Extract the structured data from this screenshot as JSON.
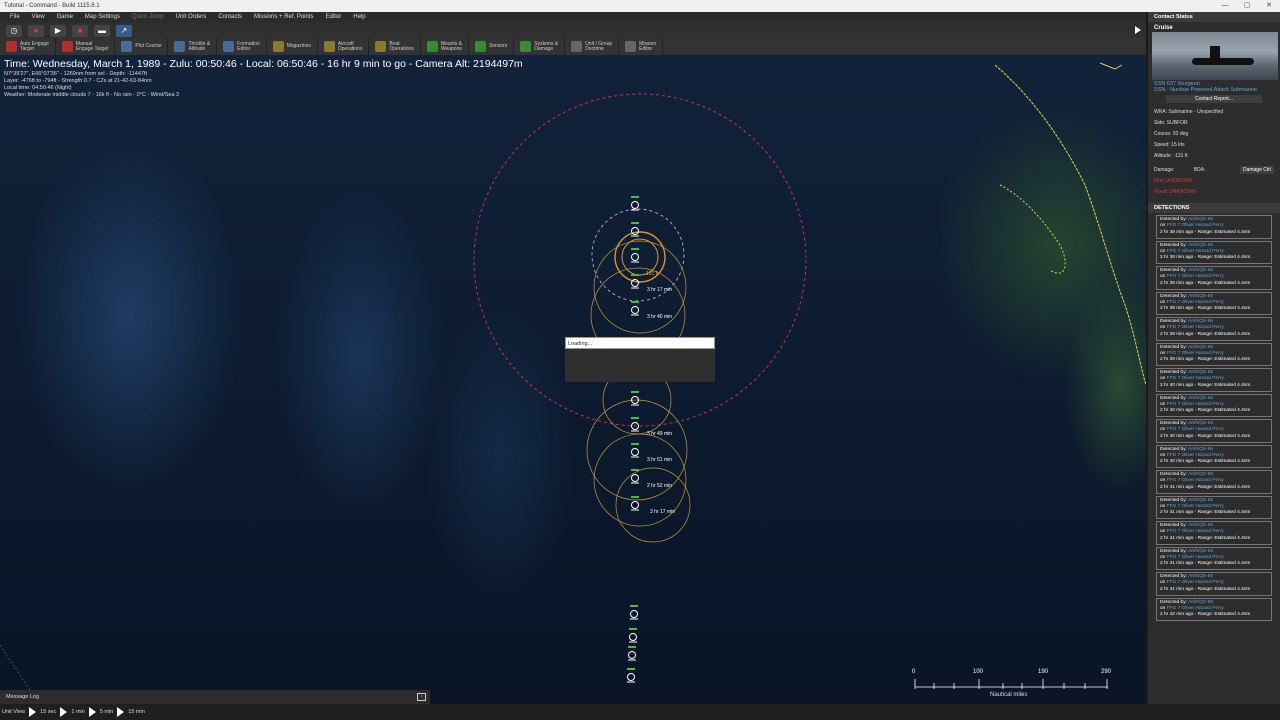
{
  "window": {
    "title": "Tutorial - Command - Build 1115.8.1",
    "controls": [
      "—",
      "▢",
      "✕"
    ]
  },
  "menu": [
    "File",
    "View",
    "Game",
    "Map Settings",
    "Quick Jump",
    "Unit Orders",
    "Contacts",
    "Missions + Ref. Points",
    "Editor",
    "Help"
  ],
  "toolbar2": [
    {
      "label": "Auto Engage\nTarget",
      "color": "#b03030"
    },
    {
      "label": "Manual\nEngage Target",
      "color": "#b03030"
    },
    {
      "label": "Plot Course",
      "color": "#4a6a9a"
    },
    {
      "label": "Throttle &\nAltitude",
      "color": "#4a6a9a"
    },
    {
      "label": "Formation\nEditor",
      "color": "#4a6a9a"
    },
    {
      "label": "Magazines",
      "color": "#8a7a30"
    },
    {
      "label": "Aircraft\nOperations",
      "color": "#8a7a30"
    },
    {
      "label": "Boat\nOperations",
      "color": "#8a7a30"
    },
    {
      "label": "Mounts &\nWeapons",
      "color": "#3a8a3a"
    },
    {
      "label": "Sensors",
      "color": "#3a8a3a"
    },
    {
      "label": "Systems &\nDamage",
      "color": "#3a8a3a"
    },
    {
      "label": "Unit / Group\nDoctrine",
      "color": "#666666"
    },
    {
      "label": "Mission\nEditor",
      "color": "#666666"
    }
  ],
  "status": {
    "time": "Time: Wednesday, March 1, 1989 - Zulu: 00:50:46 - Local: 06:50:46 - 16 hr 9 min to go -  Camera Alt: 2194497m",
    "line1": "N7°39'27\", E66°07'36\" - 1269nm from sel - Depth: -11447ft",
    "line2": "Layer: -476ft to -794ft - Strength 0.7 - CZs at 21-42-63-84nm",
    "line3": "Local time: 04:50:46 (Night)",
    "line4": "Weather: Moderate middle clouds 7 - 16k ft - No rain - 0°C - Wind/Sea 3"
  },
  "loading": "Loading...",
  "unit_labels": [
    {
      "text": "3 hr 17 min",
      "color": "white"
    },
    {
      "text": "3 hr 40 min",
      "color": "white"
    },
    {
      "text": "3 hr 49 min",
      "color": "white"
    },
    {
      "text": "3 hr 51 min",
      "color": "white"
    },
    {
      "text": "2 hr 52 min",
      "color": "white"
    },
    {
      "text": "3 hr 17 min",
      "color": "white"
    },
    {
      "text": "131 ft",
      "color": "orange"
    }
  ],
  "scale": {
    "ticks": [
      "0",
      "100",
      "190",
      "290"
    ],
    "unit": "Nautical miles"
  },
  "message_log": "Message Log",
  "bottom_bar": [
    "Unit View",
    "15 sec",
    "1 min",
    "5 min",
    "15 min"
  ],
  "panel": {
    "header": "Contact Status",
    "name": "Cruise",
    "class_link": "SSN 637 Sturgeon",
    "class_desc": "SSN - Nuclear Powered Attack Submarine",
    "report_button": "Contact Report...",
    "info": [
      "WRA: Submarine - Unspecified",
      "Side: SUBFOR",
      "Course: 93 deg",
      "Speed: 15 kts",
      "Altitude: -131 ft"
    ],
    "damage_label": "Damage:",
    "bda_label": "BDA:",
    "damage_button": "Damage Ctrl",
    "fire": "Fire: UNKNOWN",
    "flood": "Flood: UNKNOWN",
    "detections_header": "DETECTIONS",
    "detections": [
      {
        "sensor": "AN/SQS-56",
        "platform": "FFG 7 Oliver Hazard Perry",
        "ago": "2 hr 38 min ago",
        "range": "Range: Estimated 4.4nm"
      },
      {
        "sensor": "AN/SQS-56",
        "platform": "FFG 7 Oliver Hazard Perry",
        "ago": "2 hr 38 min ago",
        "range": "Range: Estimated 4.4nm"
      },
      {
        "sensor": "AN/SQS-56",
        "platform": "FFG 7 Oliver Hazard Perry",
        "ago": "2 hr 39 min ago",
        "range": "Range: Estimated 4.4nm"
      },
      {
        "sensor": "AN/SQS-56",
        "platform": "FFG 7 Oliver Hazard Perry",
        "ago": "2 hr 39 min ago",
        "range": "Range: Estimated 4.4nm"
      },
      {
        "sensor": "AN/SQS-56",
        "platform": "FFG 7 Oliver Hazard Perry",
        "ago": "2 hr 39 min ago",
        "range": "Range: Estimated 4.4nm"
      },
      {
        "sensor": "AN/SQS-56",
        "platform": "FFG 7 Oliver Hazard Perry",
        "ago": "2 hr 39 min ago",
        "range": "Range: Estimated 4.4nm"
      },
      {
        "sensor": "AN/SQS-56",
        "platform": "FFG 7 Oliver Hazard Perry",
        "ago": "2 hr 40 min ago",
        "range": "Range: Estimated 4.4nm"
      },
      {
        "sensor": "AN/SQS-56",
        "platform": "FFG 7 Oliver Hazard Perry",
        "ago": "2 hr 40 min ago",
        "range": "Range: Estimated 4.4nm"
      },
      {
        "sensor": "AN/SQS-56",
        "platform": "FFG 7 Oliver Hazard Perry",
        "ago": "2 hr 40 min ago",
        "range": "Range: Estimated 4.4nm"
      },
      {
        "sensor": "AN/SQS-56",
        "platform": "FFG 7 Oliver Hazard Perry",
        "ago": "2 hr 40 min ago",
        "range": "Range: Estimated 4.4nm"
      },
      {
        "sensor": "AN/SQS-56",
        "platform": "FFG 7 Oliver Hazard Perry",
        "ago": "2 hr 41 min ago",
        "range": "Range: Estimated 4.4nm"
      },
      {
        "sensor": "AN/SQS-56",
        "platform": "FFG 7 Oliver Hazard Perry",
        "ago": "2 hr 41 min ago",
        "range": "Range: Estimated 4.4nm"
      },
      {
        "sensor": "AN/SQS-56",
        "platform": "FFG 7 Oliver Hazard Perry",
        "ago": "2 hr 41 min ago",
        "range": "Range: Estimated 4.4nm"
      },
      {
        "sensor": "AN/SQS-56",
        "platform": "FFG 7 Oliver Hazard Perry",
        "ago": "2 hr 41 min ago",
        "range": "Range: Estimated 4.4nm"
      },
      {
        "sensor": "AN/SQS-56",
        "platform": "FFG 7 Oliver Hazard Perry",
        "ago": "2 hr 41 min ago",
        "range": "Range: Estimated 4.4nm"
      },
      {
        "sensor": "AN/SQS-56",
        "platform": "FFG 7 Oliver Hazard Perry",
        "ago": "2 hr 42 min ago",
        "range": "Range: Estimated 4.4nm"
      }
    ]
  },
  "colors": {
    "accent_link": "#5aa8e0",
    "range_ring": "#c89b3c",
    "threat_ring": "#d0304a",
    "alert": "#e33333"
  }
}
